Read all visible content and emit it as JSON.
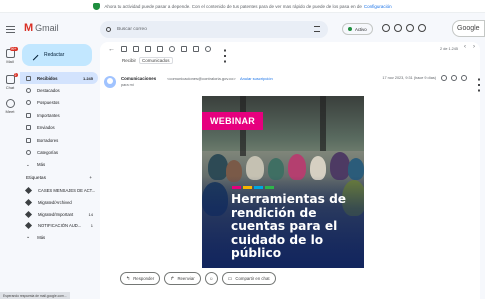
{
  "banner": {
    "text": "Ahora tu actividad puede pasar a depende. Con el contenido de tus patentes para de ver mas rápido de puede de los pasa en de",
    "link": "Configuración"
  },
  "rail": {
    "items": [
      {
        "label": "Mail",
        "badge": "99+"
      },
      {
        "label": "Chat",
        "badge": "2"
      },
      {
        "label": "Meet",
        "badge": ""
      }
    ]
  },
  "app": {
    "title": "Gmail",
    "logo_letter": "M"
  },
  "compose": {
    "label": "Redactar"
  },
  "nav": {
    "items": [
      {
        "label": "Recibidos",
        "count": "1.245",
        "active": true
      },
      {
        "label": "Destacados",
        "count": ""
      },
      {
        "label": "Pospuestos",
        "count": ""
      },
      {
        "label": "Importantes",
        "count": ""
      },
      {
        "label": "Enviados",
        "count": ""
      },
      {
        "label": "Borradores",
        "count": ""
      },
      {
        "label": "Categorías",
        "count": ""
      },
      {
        "label": "Más",
        "count": ""
      }
    ],
    "labels_heading": "Etiquetas",
    "labels_add": "+",
    "labels": [
      {
        "label": "CASES MENSAJES DE ACT...",
        "count": ""
      },
      {
        "label": "Migrated/Archived",
        "count": ""
      },
      {
        "label": "Migrated/Important",
        "count": "14"
      },
      {
        "label": "NOTIFICACIÓN AUD...",
        "count": "1"
      }
    ],
    "labels_more": "Más"
  },
  "search": {
    "placeholder": "Buscar correo"
  },
  "status": {
    "label": "Activo"
  },
  "google_apps": {
    "label": "Google"
  },
  "toolbar": {
    "pagination": "2 de 1.245"
  },
  "email": {
    "subject_prefix": "Recibir",
    "subject_chip": "Comunicados",
    "sender_name": "Comunicaciones",
    "sender_email": "<comunicaciones@contraloria.gov.co>",
    "unsubscribe": "Anular suscripción",
    "to_line": "para mí",
    "date": "17 nov 2023, 9:31 (hace 9 días)"
  },
  "hero": {
    "badge": "WEBINAR",
    "title": "Herramientas de rendición de cuentas para el cuidado de lo público",
    "stripe_colors": [
      "#e6007e",
      "#f7b500",
      "#00a7e1",
      "#2fb44a"
    ]
  },
  "actions": {
    "reply": "Responder",
    "forward": "Reenviar",
    "share": "Compartir en chat"
  },
  "statusbar": {
    "text": "Esperando respuesta de mail.google.com..."
  }
}
